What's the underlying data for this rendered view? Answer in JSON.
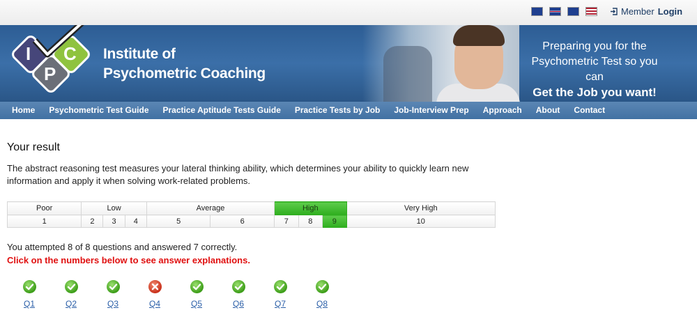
{
  "topbar": {
    "flags": [
      "australia-flag",
      "uk-flag",
      "new-zealand-flag",
      "usa-flag"
    ],
    "member_prefix": "Member",
    "member_login": "Login"
  },
  "header": {
    "logo_letters": [
      "I",
      "C",
      "P"
    ],
    "brand_line1": "Institute of",
    "brand_line2": "Psychometric Coaching",
    "tagline_line1": "Preparing you for the",
    "tagline_line2": "Psychometric Test so you can",
    "tagline_line3": "Get the Job you want!"
  },
  "nav": {
    "items": [
      "Home",
      "Psychometric Test Guide",
      "Practice Aptitude Tests Guide",
      "Practice Tests by Job",
      "Job-Interview Prep",
      "Approach",
      "About",
      "Contact"
    ]
  },
  "result": {
    "title": "Your result",
    "description": "The abstract reasoning test measures your lateral thinking ability, which determines your ability to quickly learn new information and apply it when solving work-related problems.",
    "bands": [
      "Poor",
      "Low",
      "Average",
      "High",
      "Very High"
    ],
    "scores": [
      "1",
      "2",
      "3",
      "4",
      "5",
      "6",
      "7",
      "8",
      "9",
      "10"
    ],
    "highlighted_band": "High",
    "highlighted_score": "9",
    "attempted": "You attempted 8 of 8 questions and answered 7 correctly.",
    "click_note": "Click on the numbers below to see answer explanations."
  },
  "questions": [
    {
      "label": "Q1",
      "status": "correct"
    },
    {
      "label": "Q2",
      "status": "correct"
    },
    {
      "label": "Q3",
      "status": "correct"
    },
    {
      "label": "Q4",
      "status": "incorrect"
    },
    {
      "label": "Q5",
      "status": "correct"
    },
    {
      "label": "Q6",
      "status": "correct"
    },
    {
      "label": "Q7",
      "status": "correct"
    },
    {
      "label": "Q8",
      "status": "correct"
    }
  ],
  "colors": {
    "header_blue": "#3b6fa8",
    "nav_blue": "#4a79ab",
    "highlight_green": "#3cb52a",
    "error_red": "#e01010",
    "logo_grey": "#6b6f78",
    "logo_green": "#8fc33f",
    "logo_navy": "#46467a"
  }
}
